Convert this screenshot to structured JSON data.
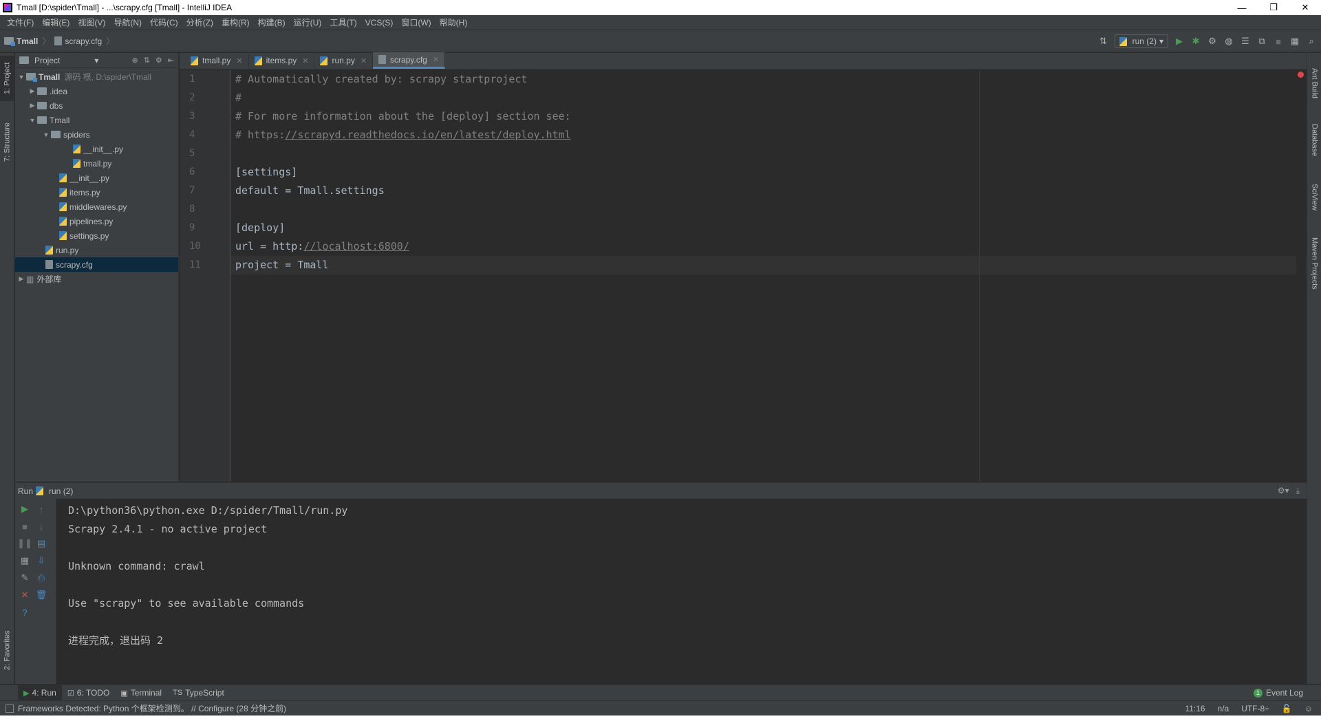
{
  "window": {
    "title": "Tmall [D:\\spider\\Tmall] - ...\\scrapy.cfg [Tmall] - IntelliJ IDEA",
    "minimize": "—",
    "maximize": "❐",
    "close": "✕"
  },
  "menu": [
    "文件(F)",
    "编辑(E)",
    "视图(V)",
    "导航(N)",
    "代码(C)",
    "分析(Z)",
    "重构(R)",
    "构建(B)",
    "运行(U)",
    "工具(T)",
    "VCS(S)",
    "窗口(W)",
    "帮助(H)"
  ],
  "breadcrumb": {
    "project": "Tmall",
    "file": "scrapy.cfg"
  },
  "toolbar": {
    "run_config": "run (2)"
  },
  "left_stripe": {
    "project": "1: Project",
    "structure": "7: Structure",
    "favorites": "2: Favorites"
  },
  "right_stripe": {
    "ant": "Ant Build",
    "database": "Database",
    "sciview": "SciView",
    "maven": "Maven Projects"
  },
  "project_panel": {
    "title": "Project",
    "tree": [
      {
        "label": "Tmall",
        "hint": "源码 根, D:\\spider\\Tmall"
      },
      {
        "label": ".idea"
      },
      {
        "label": "dbs"
      },
      {
        "label": "Tmall"
      },
      {
        "label": "spiders"
      },
      {
        "label": "__init__.py"
      },
      {
        "label": "tmall.py"
      },
      {
        "label": "__init__.py"
      },
      {
        "label": "items.py"
      },
      {
        "label": "middlewares.py"
      },
      {
        "label": "pipelines.py"
      },
      {
        "label": "settings.py"
      },
      {
        "label": "run.py"
      },
      {
        "label": "scrapy.cfg"
      },
      {
        "label": "外部库"
      }
    ]
  },
  "editor_tabs": [
    "tmall.py",
    "items.py",
    "run.py",
    "scrapy.cfg"
  ],
  "editor": {
    "line_numbers": [
      "1",
      "2",
      "3",
      "4",
      "5",
      "6",
      "7",
      "8",
      "9",
      "10",
      "11"
    ],
    "lines": [
      "# Automatically created by: scrapy startproject",
      "#",
      "# For more information about the [deploy] section see:",
      "# https://scrapyd.readthedocs.io/en/latest/deploy.html",
      "",
      "[settings]",
      "default = Tmall.settings",
      "",
      "[deploy]",
      "url = http://localhost:6800/",
      "project = Tmall"
    ],
    "line4_prefix": "# https:",
    "line4_link": "//scrapyd.readthedocs.io/en/latest/deploy.html",
    "line10_prefix": "url = http:",
    "line10_link": "//localhost:6800/"
  },
  "run_panel": {
    "label": "Run",
    "config": "run (2)",
    "console": [
      "D:\\python36\\python.exe D:/spider/Tmall/run.py",
      "Scrapy 2.4.1 - no active project",
      "",
      "Unknown command: crawl",
      "",
      "Use \"scrapy\" to see available commands",
      "",
      "进程完成，退出码 2"
    ]
  },
  "bottom_tabs": [
    "4: Run",
    "6: TODO",
    "Terminal",
    "TypeScript"
  ],
  "event_log": {
    "label": "Event Log",
    "count": "1"
  },
  "status": {
    "message": "Frameworks Detected: Python 个框架检测到。 // Configure (28 分钟之前)",
    "position": "11:16",
    "na": "n/a",
    "encoding": "UTF-8÷"
  }
}
